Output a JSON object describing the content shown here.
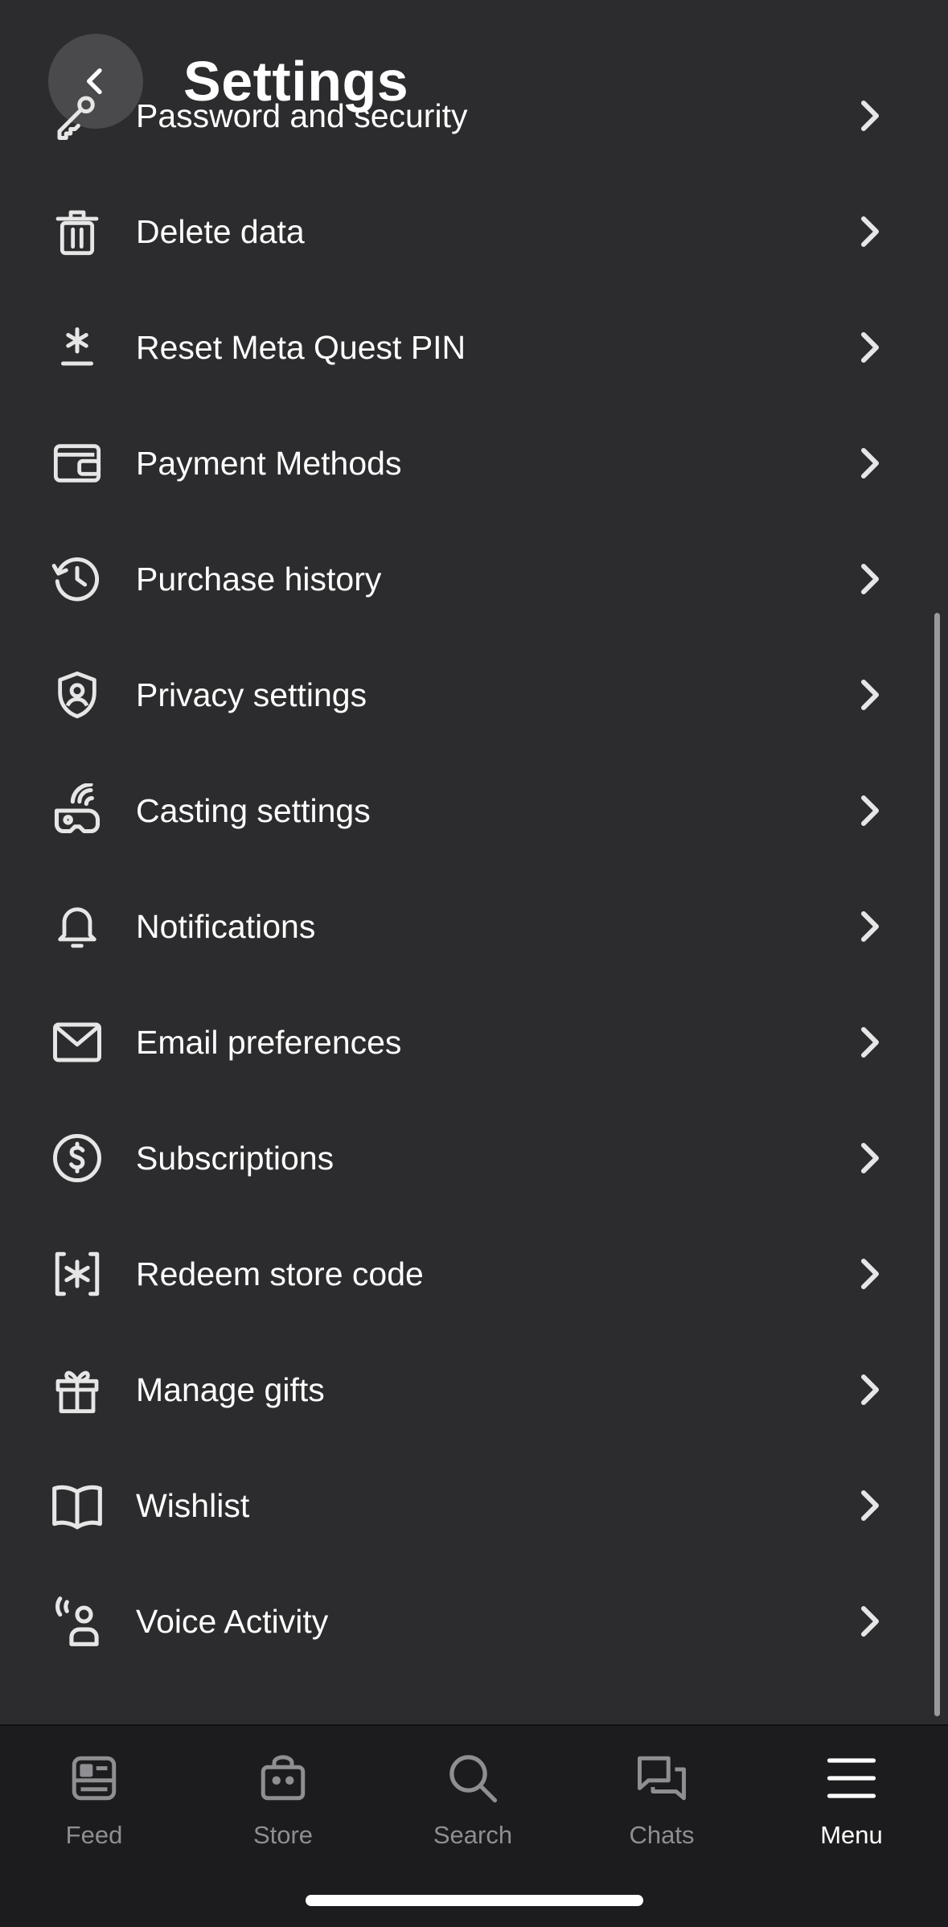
{
  "header": {
    "title": "Settings",
    "back_icon": "chevron-left-icon"
  },
  "settings": [
    {
      "label": "Password and security",
      "icon": "key-icon"
    },
    {
      "label": "Delete data",
      "icon": "trash-icon"
    },
    {
      "label": "Reset Meta Quest PIN",
      "icon": "asterisk-icon"
    },
    {
      "label": "Payment Methods",
      "icon": "wallet-icon"
    },
    {
      "label": "Purchase history",
      "icon": "history-icon"
    },
    {
      "label": "Privacy settings",
      "icon": "shield-user-icon"
    },
    {
      "label": "Casting settings",
      "icon": "headset-cast-icon"
    },
    {
      "label": "Notifications",
      "icon": "bell-icon"
    },
    {
      "label": "Email preferences",
      "icon": "envelope-icon"
    },
    {
      "label": "Subscriptions",
      "icon": "dollar-circle-icon"
    },
    {
      "label": "Redeem store code",
      "icon": "bracket-asterisk-icon"
    },
    {
      "label": "Manage gifts",
      "icon": "gift-icon"
    },
    {
      "label": "Wishlist",
      "icon": "book-icon"
    },
    {
      "label": "Voice Activity",
      "icon": "voice-user-icon"
    }
  ],
  "tabs": [
    {
      "label": "Feed",
      "icon": "feed-icon",
      "active": false
    },
    {
      "label": "Store",
      "icon": "store-bag-icon",
      "active": false
    },
    {
      "label": "Search",
      "icon": "search-icon",
      "active": false
    },
    {
      "label": "Chats",
      "icon": "chat-bubbles-icon",
      "active": false
    },
    {
      "label": "Menu",
      "icon": "hamburger-menu-icon",
      "active": true
    }
  ],
  "colors": {
    "background": "#2c2c2e",
    "tabbar": "#1c1c1e",
    "text": "#ffffff",
    "inactive": "#8e8e93",
    "back_button": "#4a4a4c"
  }
}
